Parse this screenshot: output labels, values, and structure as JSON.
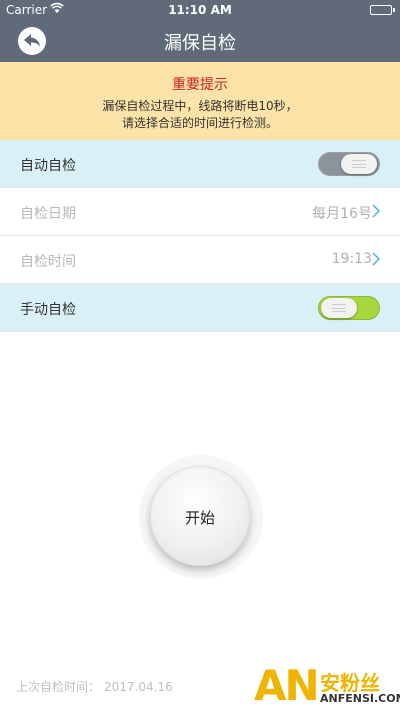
{
  "statusbar": {
    "carrier": "Carrier",
    "time": "11:10 AM"
  },
  "navbar": {
    "title": "漏保自检"
  },
  "notice": {
    "title": "重要提示",
    "line1": "漏保自检过程中，线路将断电10秒，",
    "line2": "请选择合适的时间进行检测。"
  },
  "settings": {
    "auto_check": {
      "label": "自动自检",
      "enabled": false
    },
    "check_date": {
      "label": "自检日期",
      "value": "每月16号"
    },
    "check_time": {
      "label": "自检时间",
      "value": "19:13"
    },
    "manual_check": {
      "label": "手动自检",
      "enabled": true
    }
  },
  "start_button": {
    "label": "开始"
  },
  "last_check": {
    "label": "上次自检时间：",
    "date": "2017.04.16"
  },
  "watermark": {
    "logo": "AN",
    "cn": "安粉丝",
    "en": "ANFENSI.COM"
  },
  "colors": {
    "header": "#606a78",
    "notice_bg": "#fde3a7",
    "notice_title": "#d02020",
    "row_highlight": "#d9f1f6",
    "toggle_on": "#a8d63f",
    "watermark": "#f0b400"
  },
  "icons": {
    "back": "back-arrow-icon",
    "wifi": "wifi-icon",
    "battery": "battery-icon",
    "chevron": "chevron-right-icon"
  }
}
